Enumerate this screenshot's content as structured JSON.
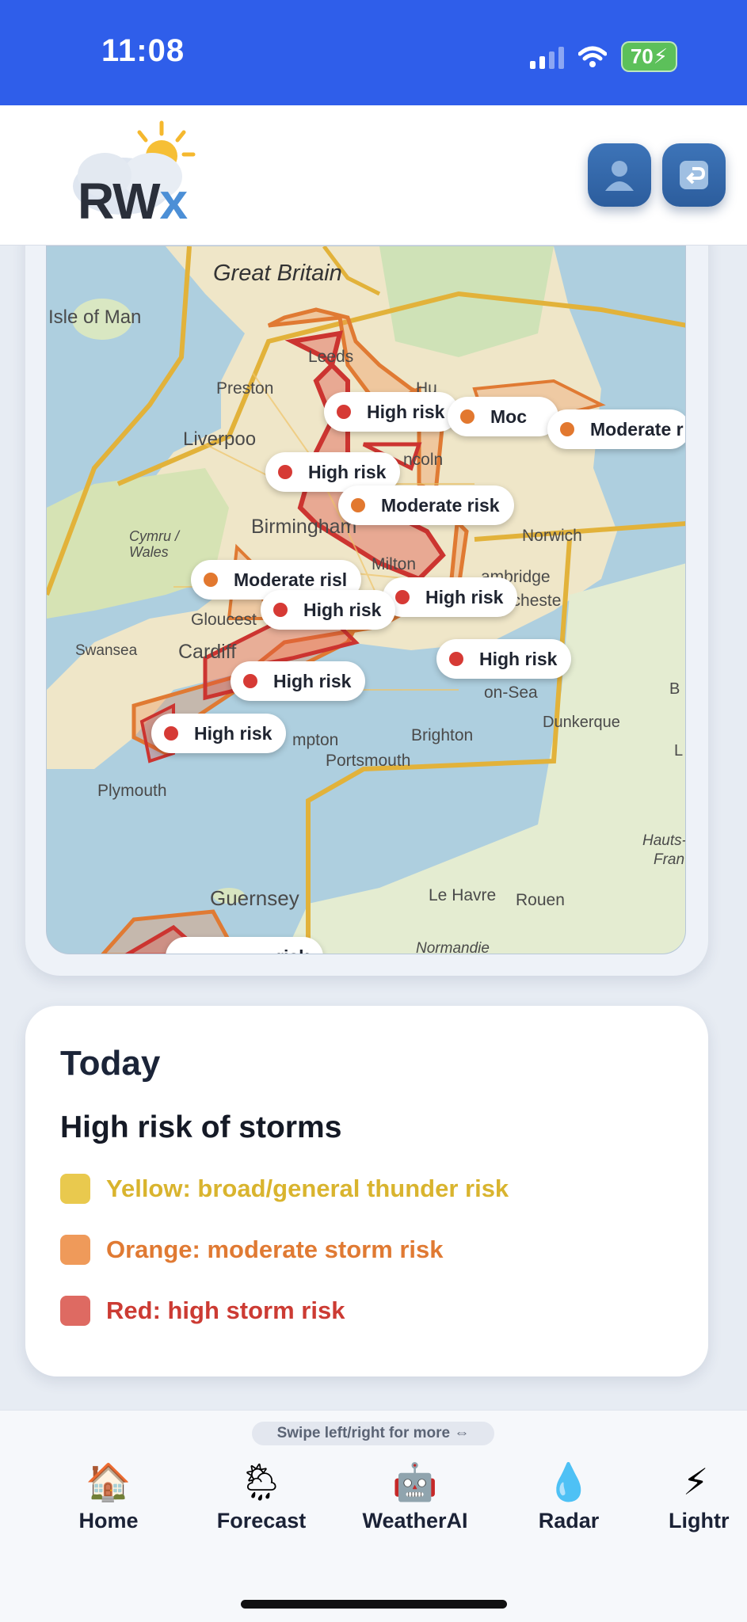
{
  "status": {
    "time": "11:08",
    "battery": "70"
  },
  "header": {
    "logo_text_main": "RW",
    "logo_text_accent": "x",
    "profile_icon": "user-icon",
    "back_icon": "return-icon"
  },
  "map": {
    "labels": {
      "great_britain": "Great Britain",
      "isle_of_man": "Isle of Man",
      "leeds": "Leeds",
      "preston": "Preston",
      "hull": "Hu",
      "liverpool": "Liverpoo",
      "lincoln": "ncoln",
      "birmingham": "Birmingham",
      "norwich": "Norwich",
      "wales": "Cymru / Wales",
      "milton": "Milton",
      "cambridge": "ambridge",
      "colchester": "Colcheste",
      "gloucester": "Gloucest",
      "swansea": "Swansea",
      "cardiff": "Cardiff",
      "on_sea": "on-Sea",
      "dunkerque": "Dunkerque",
      "southampton": "mpton",
      "brighton": "Brighton",
      "portsmouth": "Portsmouth",
      "plymouth": "Plymouth",
      "hauts": "Hauts-",
      "france": "Fran",
      "guernsey": "Guernsey",
      "le_havre": "Le Havre",
      "rouen": "Rouen",
      "normandie": "Normandie",
      "b": "B",
      "l": "L"
    },
    "markers": [
      {
        "text": "High risk",
        "level": "high"
      },
      {
        "text": "Moc",
        "level": "moderate"
      },
      {
        "text": "Moderate r",
        "level": "moderate"
      },
      {
        "text": "High risk",
        "level": "high"
      },
      {
        "text": "Moderate risk",
        "level": "moderate"
      },
      {
        "text": "Moderate risl",
        "level": "moderate"
      },
      {
        "text": "High risk",
        "level": "high"
      },
      {
        "text": "High risk",
        "level": "high"
      },
      {
        "text": "High risk",
        "level": "high"
      },
      {
        "text": "High risk",
        "level": "high"
      },
      {
        "text": "High risk",
        "level": "high"
      },
      {
        "text": "risk",
        "level": "high"
      }
    ]
  },
  "legend": {
    "day": "Today",
    "headline": "High risk of storms",
    "items": [
      {
        "label": "Yellow: broad/general thunder risk",
        "color": "#e9c94e",
        "text_color": "#d9b42e"
      },
      {
        "label": "Orange: moderate storm risk",
        "color": "#ef9a5a",
        "text_color": "#e07a33"
      },
      {
        "label": "Red: high storm risk",
        "color": "#de6a62",
        "text_color": "#cc3b33"
      }
    ]
  },
  "nav": {
    "hint": "Swipe left/right for more ⇔",
    "items": [
      {
        "label": "Home",
        "icon": "🏠"
      },
      {
        "label": "Forecast",
        "icon": "🌦"
      },
      {
        "label": "WeatherAI",
        "icon": "🤖"
      },
      {
        "label": "Radar",
        "icon": "💧"
      },
      {
        "label": "Lightr",
        "icon": "⚡"
      }
    ]
  }
}
